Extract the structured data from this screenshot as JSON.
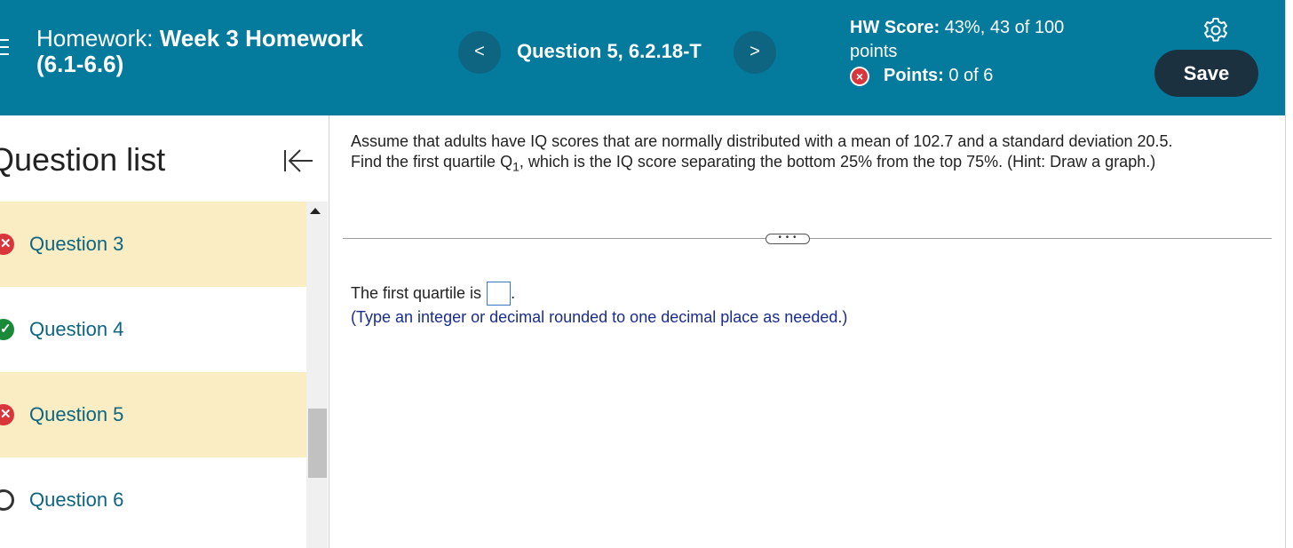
{
  "header": {
    "title_prefix": "Homework:",
    "title_name": "Week 3 Homework",
    "title_range": "(6.1-6.6)",
    "prev_label": "<",
    "next_label": ">",
    "question_label": "Question 5, 6.2.18-T",
    "hw_score_label": "HW Score:",
    "hw_score_value": "43%, 43 of 100",
    "hw_score_unit": "points",
    "points_label": "Points:",
    "points_value": "0 of 6",
    "save_label": "Save"
  },
  "sidebar": {
    "title": "Question list",
    "items": [
      {
        "label": "Question 3",
        "status": "incorrect",
        "glyph": "✕"
      },
      {
        "label": "Question 4",
        "status": "correct",
        "glyph": "✓"
      },
      {
        "label": "Question 5",
        "status": "incorrect",
        "glyph": "✕"
      },
      {
        "label": "Question 6",
        "status": "unanswered",
        "glyph": ""
      }
    ]
  },
  "main": {
    "question_line1": "Assume that adults have IQ scores that are normally distributed with a mean of 102.7 and a standard deviation 20.5.",
    "question_line2_a": "Find the first quartile Q",
    "question_line2_sub": "1",
    "question_line2_b": ", which is the IQ score separating the bottom 25% from the top 75%. (Hint: Draw a graph.)",
    "more_label": "• • •",
    "answer_prefix": "The first quartile is",
    "answer_suffix": ".",
    "answer_value": "",
    "hint": "(Type an integer or decimal rounded to one decimal place as needed.)"
  },
  "colors": {
    "header_bg": "#047a9c",
    "nav_button_bg": "#0d6582",
    "save_button_bg": "#1c3140",
    "highlight_row": "#faecc3",
    "incorrect": "#d9363b",
    "correct": "#1a8a3a",
    "link_text": "#0d6582",
    "hint_text": "#1a2c8c"
  },
  "icons": {
    "menu": "menu-icon",
    "settings": "gear-icon",
    "collapse": "collapse-left-icon",
    "points_status": "x-circle-icon"
  }
}
